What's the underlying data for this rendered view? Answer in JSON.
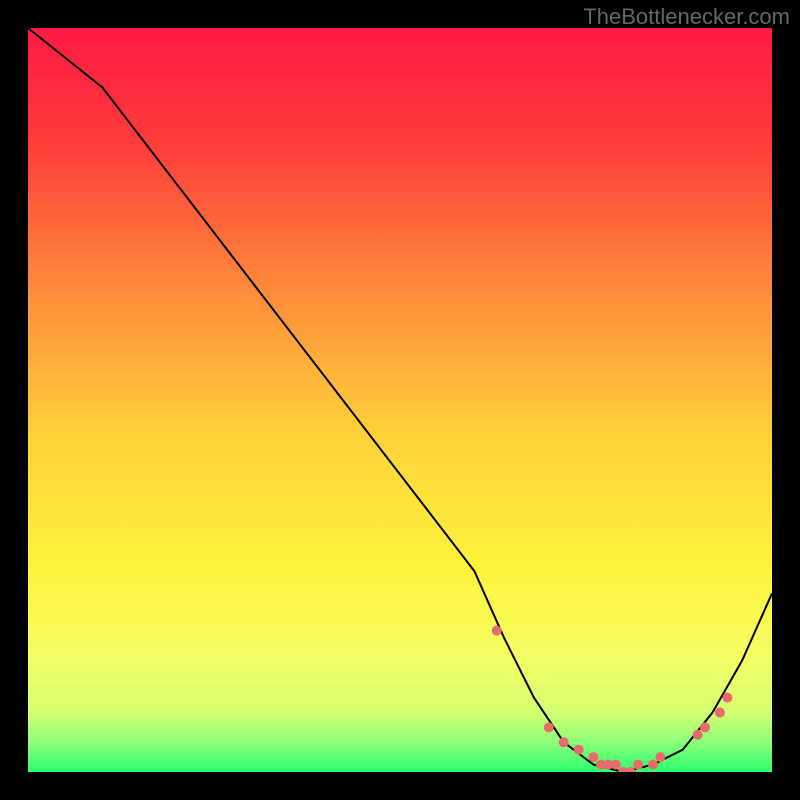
{
  "watermark": "TheBottlenecker.com",
  "chart_data": {
    "type": "line",
    "title": "",
    "xlabel": "",
    "ylabel": "",
    "xlim": [
      0,
      100
    ],
    "ylim": [
      0,
      100
    ],
    "series": [
      {
        "name": "bottleneck-curve",
        "x": [
          0,
          10,
          20,
          30,
          40,
          50,
          60,
          64,
          68,
          72,
          76,
          80,
          84,
          88,
          92,
          96,
          100
        ],
        "values": [
          100,
          92,
          79,
          66,
          53,
          40,
          27,
          18,
          10,
          4,
          1,
          0,
          1,
          3,
          8,
          15,
          24
        ]
      }
    ],
    "markers": {
      "name": "highlight-dots",
      "x": [
        63,
        70,
        72,
        74,
        76,
        77,
        78,
        79,
        80,
        81,
        82,
        84,
        85,
        90,
        91,
        93,
        94
      ],
      "values": [
        19,
        6,
        4,
        3,
        2,
        1,
        1,
        1,
        0,
        0,
        1,
        1,
        2,
        5,
        6,
        8,
        10
      ]
    },
    "gradient_stops": [
      {
        "pos": 0.0,
        "color": "#ff1a44"
      },
      {
        "pos": 0.15,
        "color": "#ff3b3b"
      },
      {
        "pos": 0.35,
        "color": "#ff8a3a"
      },
      {
        "pos": 0.55,
        "color": "#ffd23a"
      },
      {
        "pos": 0.72,
        "color": "#fff23a"
      },
      {
        "pos": 0.85,
        "color": "#f4ff66"
      },
      {
        "pos": 0.92,
        "color": "#d2ff70"
      },
      {
        "pos": 0.96,
        "color": "#8cff7a"
      },
      {
        "pos": 1.0,
        "color": "#2cff6a"
      }
    ],
    "marker_color": "#e86a6a",
    "line_color": "#000000"
  }
}
